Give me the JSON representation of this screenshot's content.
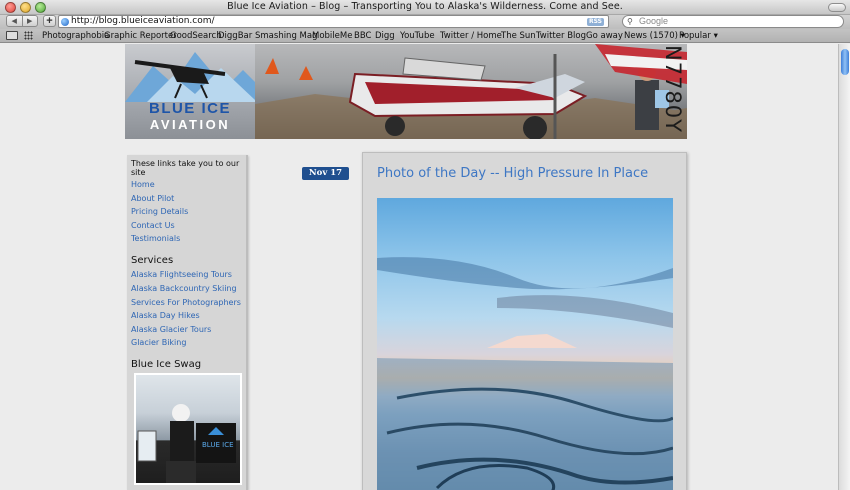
{
  "window": {
    "title": "Blue Ice Aviation – Blog – Transporting You to Alaska's Wilderness. Come and See."
  },
  "toolbar": {
    "back_icon": "◀",
    "forward_icon": "▶",
    "add_icon": "+",
    "url": "http://blog.blueiceaviation.com/",
    "rss_label": "RSS",
    "search_placeholder": "Google"
  },
  "bookmarks": [
    {
      "label": "Photographobia"
    },
    {
      "label": "Graphic Reporter"
    },
    {
      "label": "GoodSearch"
    },
    {
      "label": "DiggBar"
    },
    {
      "label": "Smashing Mag"
    },
    {
      "label": "MobileMe"
    },
    {
      "label": "BBC"
    },
    {
      "label": "Digg"
    },
    {
      "label": "YouTube"
    },
    {
      "label": "Twitter / Home"
    },
    {
      "label": "The Sun"
    },
    {
      "label": "Twitter Blog"
    },
    {
      "label": "Go away"
    },
    {
      "label": "News (1570) ▾"
    },
    {
      "label": "Popular ▾"
    }
  ],
  "header": {
    "logo_line1": "BLUE ICE",
    "logo_line2": "AVIATION",
    "plane_number": "N7780Y"
  },
  "sidebar": {
    "intro": "These links take you to our site",
    "links": [
      {
        "label": "Home"
      },
      {
        "label": "About Pilot"
      },
      {
        "label": "Pricing Details"
      },
      {
        "label": "Contact Us"
      },
      {
        "label": "Testimonials"
      }
    ],
    "services_heading": "Services",
    "services": [
      {
        "label": "Alaska Flightseeing Tours"
      },
      {
        "label": "Alaska Backcountry Skiing"
      },
      {
        "label": "Services For Photographers"
      },
      {
        "label": "Alaska Day Hikes"
      },
      {
        "label": "Alaska Glacier Tours"
      },
      {
        "label": "Glacier Biking"
      }
    ],
    "swag_heading": "Blue Ice Swag"
  },
  "post": {
    "date": "Nov 17",
    "title": "Photo of the Day -- High Pressure In Place"
  },
  "colors": {
    "link": "#2e66b4",
    "post_title": "#3e77c4",
    "date_badge": "#1f4f8f",
    "brand_blue": "#1e55a8"
  }
}
